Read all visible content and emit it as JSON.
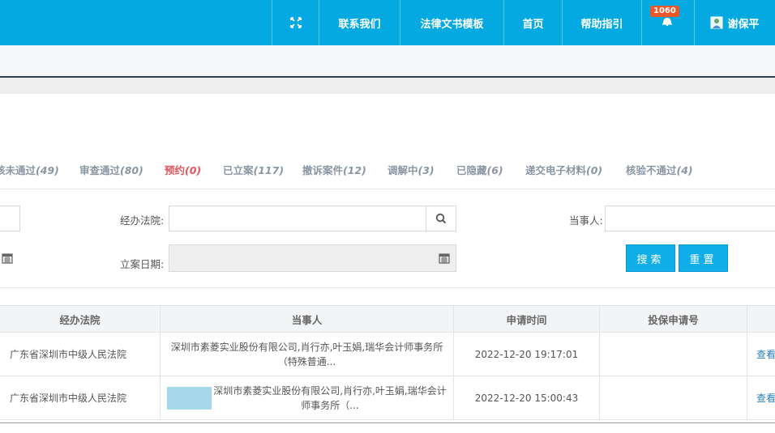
{
  "header": {
    "nav": {
      "contact": "联系我们",
      "template": "法律文书模板",
      "home": "首页",
      "help": "帮助指引",
      "notice_count": "1060",
      "user_name": "谢保平"
    }
  },
  "tabs": [
    {
      "label": "审核未通过",
      "visible_label": "核未通过",
      "count": "(49)"
    },
    {
      "label": "审查通过",
      "count": "(80)"
    },
    {
      "label": "预约",
      "count": "(0)",
      "active": true
    },
    {
      "label": "已立案",
      "count": "(117)"
    },
    {
      "label": "撤诉案件",
      "count": "(12)"
    },
    {
      "label": "调解中",
      "count": "(3)"
    },
    {
      "label": "已隐藏",
      "count": "(6)"
    },
    {
      "label": "递交电子材料",
      "count": "(0)"
    },
    {
      "label": "核验不通过",
      "count": "(4)"
    }
  ],
  "filters": {
    "court_label": "经办法院:",
    "court_value": "",
    "party_label": "当事人:",
    "party_value": "",
    "filing_date_label": "立案日期:",
    "filing_date_value": "",
    "search_button": "搜索",
    "reset_button": "重置"
  },
  "table": {
    "columns": [
      "经办法院",
      "当事人",
      "申请时间",
      "投保申请号"
    ],
    "rows": [
      {
        "court": "广东省深圳市中级人民法院",
        "party": "深圳市素菱实业股份有限公司,肖行亦,叶玉娟,瑞华会计师事务所（特殊普通...",
        "apply_time": "2022-12-20 19:17:01",
        "policy_no": "",
        "action": "查看"
      },
      {
        "court": "广东省深圳市中级人民法院",
        "party": "深圳市素菱实业股份有限公司,肖行亦,叶玉娟,瑞华会计师事务所（...",
        "apply_time": "2022-12-20 15:00:43",
        "policy_no": "",
        "action": "查看"
      }
    ]
  },
  "colors": {
    "topbar": "#03a9e0",
    "active_tab": "#e5555d",
    "button": "#10aee8",
    "link": "#2a7fbf"
  }
}
